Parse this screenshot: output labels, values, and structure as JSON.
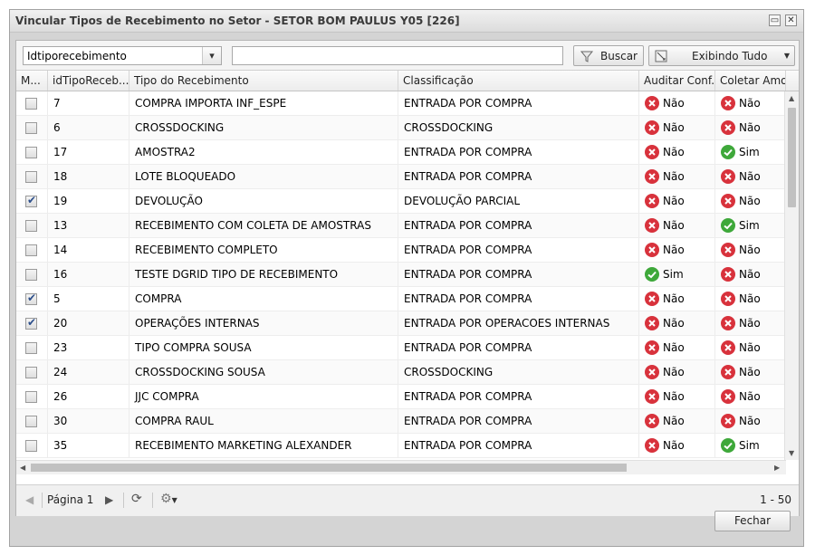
{
  "window": {
    "title": "Vincular Tipos de Recebimento no Setor - SETOR BOM PAULUS Y05 [226]"
  },
  "toolbar": {
    "filter_field": "Idtiporecebimento",
    "search_value": "",
    "search_label": "Buscar",
    "view_label": "Exibindo Tudo"
  },
  "columns": [
    "M...",
    "idTipoReceb...",
    "Tipo do Recebimento",
    "Classificação",
    "Auditar Conf...",
    "Coletar Amo..."
  ],
  "rows": [
    {
      "checked": false,
      "id": "7",
      "tipo": "COMPRA IMPORTA INF_ESPE",
      "classificacao": "ENTRADA POR COMPRA",
      "auditar": "Não",
      "coletar": "Não"
    },
    {
      "checked": false,
      "id": "6",
      "tipo": "CROSSDOCKING",
      "classificacao": "CROSSDOCKING",
      "auditar": "Não",
      "coletar": "Não"
    },
    {
      "checked": false,
      "id": "17",
      "tipo": "AMOSTRA2",
      "classificacao": "ENTRADA POR COMPRA",
      "auditar": "Não",
      "coletar": "Sim"
    },
    {
      "checked": false,
      "id": "18",
      "tipo": "LOTE BLOQUEADO",
      "classificacao": "ENTRADA POR COMPRA",
      "auditar": "Não",
      "coletar": "Não"
    },
    {
      "checked": true,
      "id": "19",
      "tipo": "DEVOLUÇÃO",
      "classificacao": "DEVOLUÇÃO PARCIAL",
      "auditar": "Não",
      "coletar": "Não"
    },
    {
      "checked": false,
      "id": "13",
      "tipo": "RECEBIMENTO COM COLETA DE AMOSTRAS",
      "classificacao": "ENTRADA POR COMPRA",
      "auditar": "Não",
      "coletar": "Sim"
    },
    {
      "checked": false,
      "id": "14",
      "tipo": "RECEBIMENTO COMPLETO",
      "classificacao": "ENTRADA POR COMPRA",
      "auditar": "Não",
      "coletar": "Não"
    },
    {
      "checked": false,
      "id": "16",
      "tipo": "TESTE DGRID TIPO DE RECEBIMENTO",
      "classificacao": "ENTRADA POR COMPRA",
      "auditar": "Sim",
      "coletar": "Não"
    },
    {
      "checked": true,
      "id": "5",
      "tipo": "COMPRA",
      "classificacao": "ENTRADA POR COMPRA",
      "auditar": "Não",
      "coletar": "Não"
    },
    {
      "checked": true,
      "id": "20",
      "tipo": "OPERAÇÕES INTERNAS",
      "classificacao": "ENTRADA POR OPERACOES INTERNAS",
      "auditar": "Não",
      "coletar": "Não"
    },
    {
      "checked": false,
      "id": "23",
      "tipo": "TIPO COMPRA SOUSA",
      "classificacao": "ENTRADA POR COMPRA",
      "auditar": "Não",
      "coletar": "Não"
    },
    {
      "checked": false,
      "id": "24",
      "tipo": "CROSSDOCKING SOUSA",
      "classificacao": "CROSSDOCKING",
      "auditar": "Não",
      "coletar": "Não"
    },
    {
      "checked": false,
      "id": "26",
      "tipo": "JJC COMPRA",
      "classificacao": "ENTRADA POR COMPRA",
      "auditar": "Não",
      "coletar": "Não"
    },
    {
      "checked": false,
      "id": "30",
      "tipo": "COMPRA RAUL",
      "classificacao": "ENTRADA POR COMPRA",
      "auditar": "Não",
      "coletar": "Não"
    },
    {
      "checked": false,
      "id": "35",
      "tipo": "RECEBIMENTO MARKETING ALEXANDER",
      "classificacao": "ENTRADA POR COMPRA",
      "auditar": "Não",
      "coletar": "Sim"
    }
  ],
  "pager": {
    "page_label": "Página 1",
    "range": "1 - 50"
  },
  "footer": {
    "close_label": "Fechar"
  },
  "colors": {
    "no_icon": "#d8323c",
    "yes_icon": "#3ea83a"
  }
}
